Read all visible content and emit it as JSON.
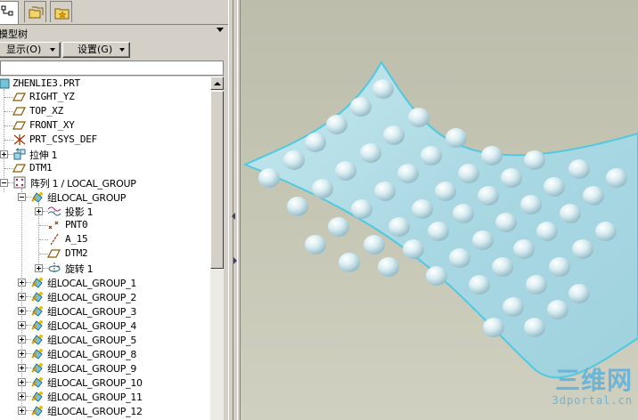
{
  "panel": {
    "title": "模型树",
    "show_button": "显示(O)",
    "settings_button": "设置(G)"
  },
  "tree": {
    "items": [
      {
        "label": "ZHENLIE3.PRT",
        "icon": "part-icon"
      },
      {
        "label": "RIGHT_YZ",
        "icon": "datum-plane-icon"
      },
      {
        "label": "TOP_XZ",
        "icon": "datum-plane-icon"
      },
      {
        "label": "FRONT_XY",
        "icon": "datum-plane-icon"
      },
      {
        "label": "PRT_CSYS_DEF",
        "icon": "csys-icon"
      },
      {
        "label": "拉伸 1",
        "icon": "extrude-icon"
      },
      {
        "label": "DTM1",
        "icon": "datum-plane-icon"
      },
      {
        "label": "阵列 1 / LOCAL_GROUP",
        "icon": "pattern-icon"
      },
      {
        "label": "组LOCAL_GROUP",
        "icon": "group-icon"
      },
      {
        "label": "投影 1",
        "icon": "projection-icon"
      },
      {
        "label": "PNT0",
        "icon": "datum-point-icon"
      },
      {
        "label": "A_15",
        "icon": "datum-axis-icon"
      },
      {
        "label": "DTM2",
        "icon": "datum-plane-icon"
      },
      {
        "label": "旋转 1",
        "icon": "revolve-icon"
      },
      {
        "label": "组LOCAL_GROUP_1",
        "icon": "group-icon"
      },
      {
        "label": "组LOCAL_GROUP_2",
        "icon": "group-icon"
      },
      {
        "label": "组LOCAL_GROUP_3",
        "icon": "group-icon"
      },
      {
        "label": "组LOCAL_GROUP_4",
        "icon": "group-icon"
      },
      {
        "label": "组LOCAL_GROUP_5",
        "icon": "group-icon"
      },
      {
        "label": "组LOCAL_GROUP_8",
        "icon": "group-icon"
      },
      {
        "label": "组LOCAL_GROUP_9",
        "icon": "group-icon"
      },
      {
        "label": "组LOCAL_GROUP_10",
        "icon": "group-icon"
      },
      {
        "label": "组LOCAL_GROUP_11",
        "icon": "group-icon"
      },
      {
        "label": "组LOCAL_GROUP_12",
        "icon": "group-icon"
      }
    ]
  },
  "viewport": {
    "watermark": "三维网",
    "watermark_url": "3dportal.cn"
  },
  "colors": {
    "surface": "#b3dde6",
    "surface_edge": "#4fc9e0",
    "bump": "#cfe6ec",
    "background": "#c4c4b3",
    "watermark": "#6bb5d8"
  }
}
